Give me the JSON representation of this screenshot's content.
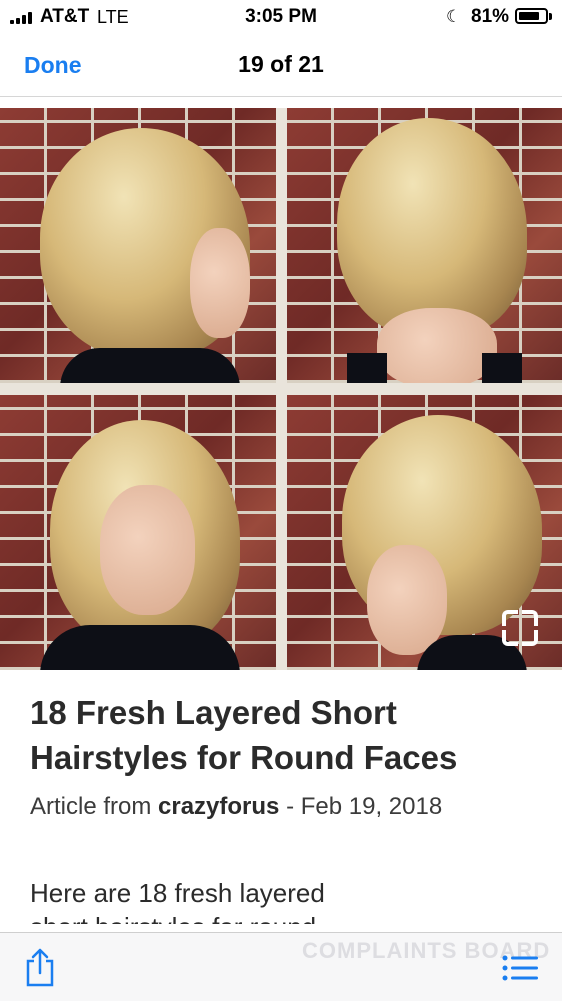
{
  "status_bar": {
    "carrier": "AT&T",
    "network": "LTE",
    "time": "3:05 PM",
    "battery_percent": "81%",
    "battery_level": 0.81
  },
  "nav": {
    "done_label": "Done",
    "counter": "19 of 21"
  },
  "article": {
    "title": "18 Fresh Layered Short Hairstyles for Round Faces",
    "source_prefix": "Article from ",
    "source": "crazyforus",
    "date_sep": " - ",
    "date": "Feb 19, 2018",
    "description_line1": "Here are 18 fresh layered",
    "description_line2": "short hairstyles for round"
  },
  "toolbar": {
    "watermark": "COMPLAINTS BOARD"
  },
  "colors": {
    "link": "#1a7ef0",
    "text": "#2b2b2b"
  },
  "icons": {
    "share": "share-icon",
    "list": "list-icon",
    "expand": "expand-icon"
  }
}
